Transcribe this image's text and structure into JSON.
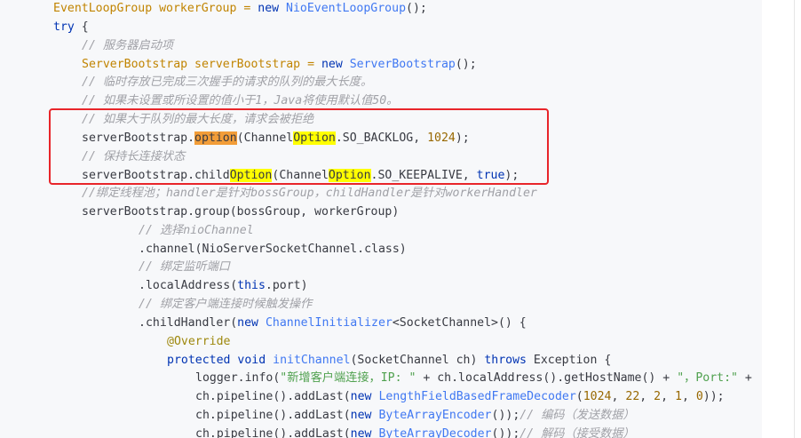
{
  "code": {
    "l01": {
      "a": "EventLoopGroup workerGroup = ",
      "b": "new",
      "c": " ",
      "d": "NioEventLoopGroup",
      "e": "();"
    },
    "l02": {
      "a": "try",
      "b": " {"
    },
    "l03": {
      "a": "// 服务器启动项"
    },
    "l04": {
      "a": "ServerBootstrap serverBootstrap = ",
      "b": "new",
      "c": " ",
      "d": "ServerBootstrap",
      "e": "();"
    },
    "l05": {
      "a": "// 临时存放已完成三次握手的请求的队列的最大长度。"
    },
    "l06": {
      "a": "// 如果未设置或所设置的值小于1，Java将使用默认值50。"
    },
    "l07": {
      "a": "// 如果大于队列的最大长度，请求会被拒绝"
    },
    "l08": {
      "a": "serverBootstrap.",
      "b": "option",
      "c": "(Channel",
      "d": "Option",
      "e": ".SO_BACKLOG, ",
      "f": "1024",
      "g": ");"
    },
    "l09": {
      "a": "// 保持长连接状态"
    },
    "l10": {
      "a": "serverBootstrap.child",
      "b": "Option",
      "c": "(Channel",
      "d": "Option",
      "e": ".SO_KEEPALIVE, ",
      "f": "true",
      "g": ");"
    },
    "l11": {
      "a": "//绑定线程池；handler是针对bossGroup，childHandler是针对workerHandler"
    },
    "l12": {
      "a": "serverBootstrap.group(bossGroup, workerGroup)"
    },
    "l13": {
      "a": "// 选择nioChannel"
    },
    "l14": {
      "a": ".channel(NioServerSocketChannel.class)"
    },
    "l15": {
      "a": "// 绑定监听端口"
    },
    "l16": {
      "a": ".localAddress(",
      "b": "this",
      "c": ".port)"
    },
    "l17": {
      "a": "// 绑定客户端连接时候触发操作"
    },
    "l18": {
      "a": ".childHandler(",
      "b": "new",
      "c": " ",
      "d": "ChannelInitializer",
      "e": "<SocketChannel>() {"
    },
    "l19": {
      "a": "@Override"
    },
    "l20": {
      "a": "protected",
      "b": " ",
      "c": "void",
      "d": " ",
      "e": "initChannel",
      "f": "(SocketChannel ch) ",
      "g": "throws",
      "h": " Exception {"
    },
    "l21": {
      "a": "logger.info(",
      "b": "\"新增客户端连接，IP: \"",
      "c": " + ch.localAddress().getHostName() + ",
      "d": "\"，Port:\"",
      "e": " +"
    },
    "l22": {
      "a": "ch.pipeline().addLast(",
      "b": "new",
      "c": " ",
      "d": "LengthFieldBasedFrameDecoder",
      "e": "(",
      "f": "1024",
      "g": ", ",
      "h": "22",
      "i": ", ",
      "j": "2",
      "k": ", ",
      "l": "1",
      "m": ", ",
      "n": "0",
      "o": "));"
    },
    "l23": {
      "a": "ch.pipeline().addLast(",
      "b": "new",
      "c": " ",
      "d": "ByteArrayEncoder",
      "e": "());",
      "f": "// 编码（发送数据）"
    },
    "l24": {
      "a": "ch.pipeline().addLast(",
      "b": "new",
      "c": " ",
      "d": "ByteArrayDecoder",
      "e": "());",
      "f": "// 解码（接受数据）"
    }
  }
}
